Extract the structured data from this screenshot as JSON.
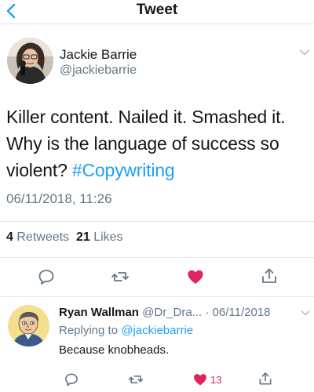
{
  "header": {
    "title": "Tweet"
  },
  "tweet": {
    "author_name": "Jackie Barrie",
    "author_handle": "@jackiebarrie",
    "text": "Killer content. Nailed it. Smashed it. Why is the language of success so violent?",
    "hashtag": "#Copywriting",
    "timestamp": "06/11/2018, 11:26",
    "retweet_count": "4",
    "retweet_label": "Retweets",
    "like_count": "21",
    "like_label": "Likes"
  },
  "reply": {
    "author_name": "Ryan Wallman",
    "author_handle": "@Dr_Dra...",
    "date": "· 06/11/2018",
    "replying_to_prefix": "Replying to",
    "replying_to_handle": "@jackiebarrie",
    "text": "Because knobheads.",
    "like_count": "13"
  },
  "colors": {
    "accent": "#1da1f2",
    "like": "#e0245e",
    "muted": "#657786"
  },
  "icons": [
    "back-arrow-icon",
    "chevron-down-icon",
    "reply-icon",
    "retweet-icon",
    "like-heart-icon",
    "share-icon"
  ]
}
